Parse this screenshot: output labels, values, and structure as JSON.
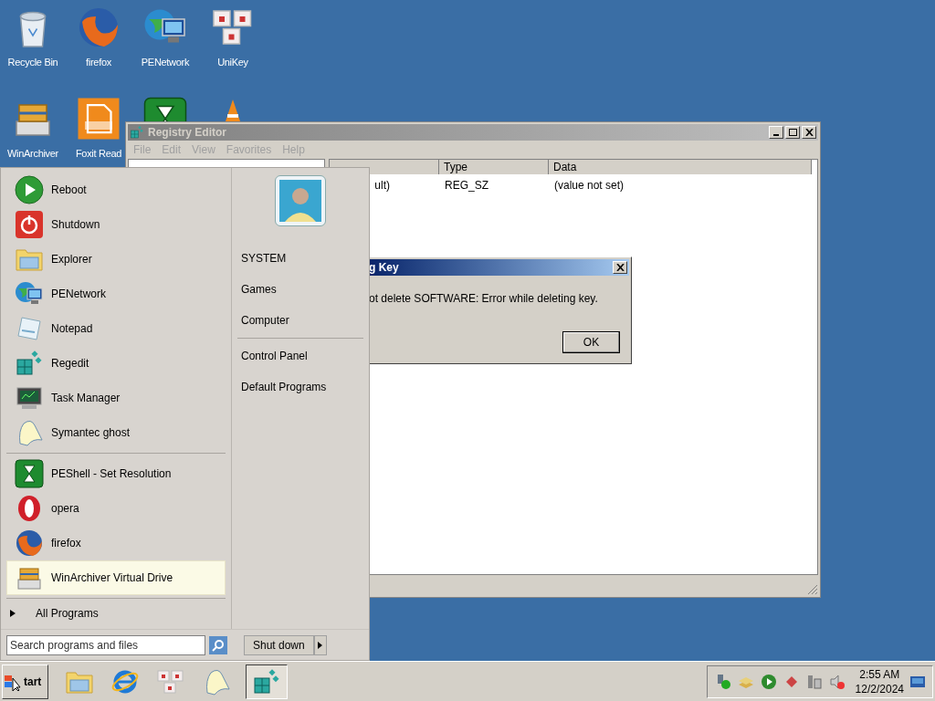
{
  "desktop_icons": [
    {
      "label": "Recycle Bin"
    },
    {
      "label": "firefox"
    },
    {
      "label": "PENetwork"
    },
    {
      "label": "UniKey"
    },
    {
      "label": "WinArchiver"
    },
    {
      "label": "Foxit Read"
    }
  ],
  "registry_editor": {
    "title": "Registry Editor",
    "menu": [
      "File",
      "Edit",
      "View",
      "Favorites",
      "Help"
    ],
    "columns": [
      "",
      "Type",
      "Data"
    ],
    "rows": [
      [
        "ult)",
        "REG_SZ",
        "(value not set)"
      ]
    ]
  },
  "error_dialog": {
    "title": "g Key",
    "message": "ot delete SOFTWARE:  Error while deleting key.",
    "button": "OK"
  },
  "start_menu": {
    "items": [
      {
        "label": "Reboot",
        "selected": false
      },
      {
        "label": "Shutdown",
        "selected": false
      },
      {
        "label": "Explorer",
        "selected": false
      },
      {
        "label": "PENetwork",
        "selected": false
      },
      {
        "label": "Notepad",
        "selected": false
      },
      {
        "label": "Regedit",
        "selected": false
      },
      {
        "label": "Task Manager",
        "selected": false
      },
      {
        "label": "Symantec ghost",
        "selected": false
      }
    ],
    "pinned": [
      {
        "label": "PEShell - Set Resolution",
        "selected": false
      },
      {
        "label": "opera",
        "selected": false
      },
      {
        "label": "firefox",
        "selected": false
      },
      {
        "label": "WinArchiver Virtual Drive",
        "selected": true
      }
    ],
    "all_programs": "All Programs",
    "search": {
      "placeholder": "Search programs and files"
    },
    "places": [
      [
        "SYSTEM",
        "Games",
        "Computer"
      ],
      [
        "Control Panel",
        "Default Programs"
      ]
    ],
    "shutdown_button": "Shut down"
  },
  "taskbar": {
    "start": "tart",
    "apps": [
      {
        "active": false
      },
      {
        "active": false
      },
      {
        "active": false
      },
      {
        "active": false
      },
      {
        "active": true
      }
    ],
    "time": "2:55 AM",
    "date": "12/2/2024"
  }
}
